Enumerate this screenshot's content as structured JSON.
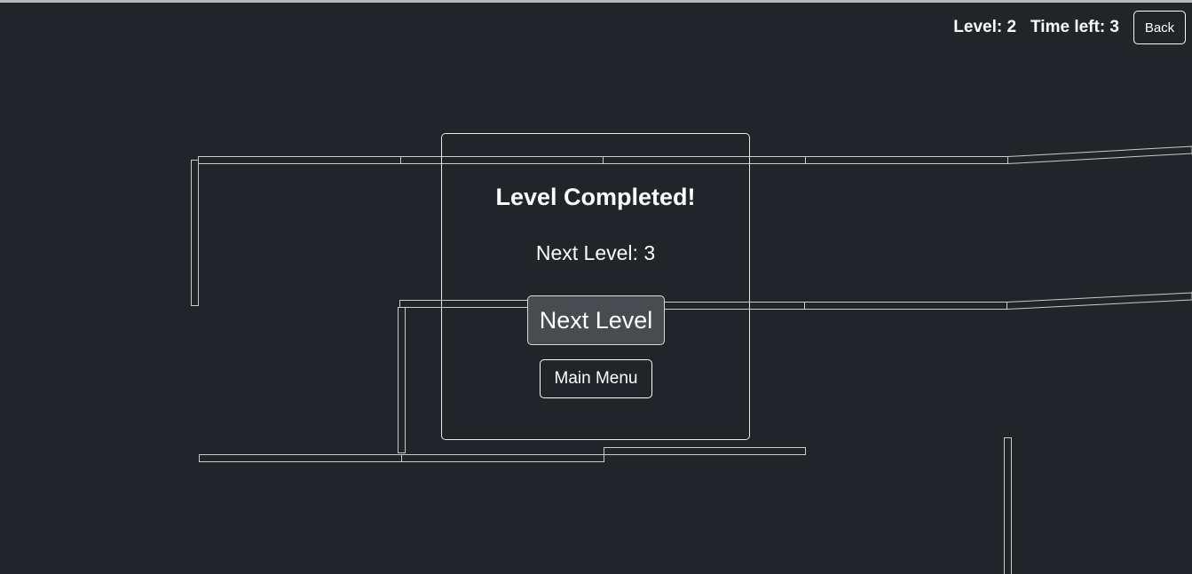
{
  "hud": {
    "level_text": "Level: 2",
    "time_text": "Time left: 3",
    "back_label": "Back"
  },
  "dialog": {
    "title": "Level Completed!",
    "subtitle": "Next Level: 3",
    "next_label": "Next Level",
    "menu_label": "Main Menu"
  },
  "colors": {
    "background": "#212529",
    "wall_stroke": "#c9cbcd",
    "next_button_bg": "#484b4f"
  }
}
